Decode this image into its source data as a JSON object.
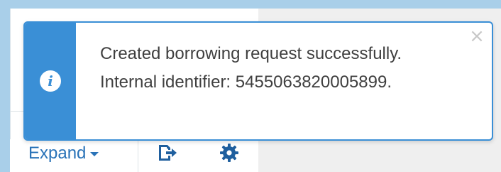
{
  "notification": {
    "message": "Created borrowing request successfully. Internal identifier: 5455063820005899.",
    "close_glyph": "×",
    "info_glyph": "i",
    "colors": {
      "accent": "#3a8fd6",
      "text": "#3f3f3f",
      "close": "#c7c7c7"
    }
  },
  "toolbar": {
    "expand_label": "Expand",
    "icons": [
      "caret-down-icon",
      "export-icon",
      "gear-icon"
    ],
    "link_color": "#2a73b8"
  }
}
